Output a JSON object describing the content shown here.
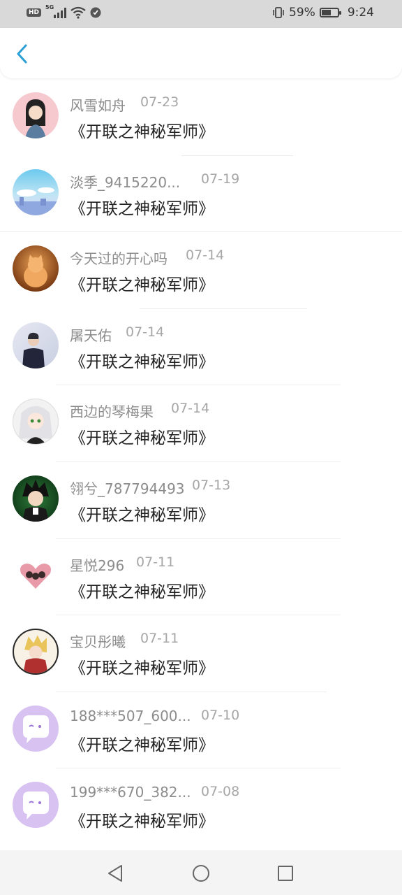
{
  "status_bar": {
    "hd": "HD",
    "network": "5G",
    "battery": "59%",
    "battery_level": 0.59,
    "time": "9:24"
  },
  "header": {
    "back_icon": "chevron-left-icon",
    "accent": "#2a9fd6"
  },
  "items": [
    {
      "name": "风雪如舟",
      "date": "07-23",
      "title": "《开联之神秘军师》"
    },
    {
      "name": "淡季_9415220...",
      "date": "07-19",
      "title": "《开联之神秘军师》"
    },
    {
      "name": "今天过的开心吗",
      "date": "07-14",
      "title": "《开联之神秘军师》"
    },
    {
      "name": "屠天佑",
      "date": "07-14",
      "title": "《开联之神秘军师》"
    },
    {
      "name": "西边的琴梅果",
      "date": "07-14",
      "title": "《开联之神秘军师》"
    },
    {
      "name": "翎兮_787794493",
      "date": "07-13",
      "title": "《开联之神秘军师》"
    },
    {
      "name": "星悦296",
      "date": "07-11",
      "title": "《开联之神秘军师》"
    },
    {
      "name": "宝贝彤曦",
      "date": "07-11",
      "title": "《开联之神秘军师》"
    },
    {
      "name": "188***507_600...",
      "date": "07-10",
      "title": "《开联之神秘军师》"
    },
    {
      "name": "199***670_382...",
      "date": "07-08",
      "title": "《开联之神秘军师》"
    }
  ],
  "nav": {
    "back": "triangle-back-icon",
    "home": "circle-home-icon",
    "recents": "square-recents-icon"
  }
}
